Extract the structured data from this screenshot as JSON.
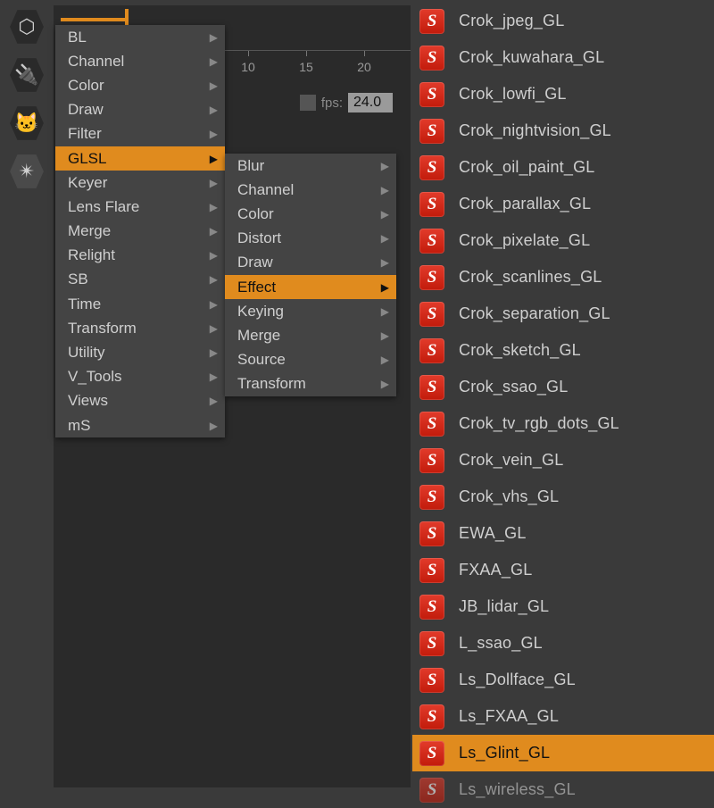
{
  "tool_icons": [
    "hex",
    "plug",
    "emoji",
    "star"
  ],
  "timeline": {
    "ticks": [
      "10",
      "15",
      "20"
    ],
    "fps_label": "fps:",
    "fps_value": "24.0"
  },
  "menu1": {
    "items": [
      {
        "label": "BL",
        "sub": true
      },
      {
        "label": "Channel",
        "sub": true
      },
      {
        "label": "Color",
        "sub": true
      },
      {
        "label": "Draw",
        "sub": true
      },
      {
        "label": "Filter",
        "sub": true
      },
      {
        "label": "GLSL",
        "sub": true,
        "hl": true
      },
      {
        "label": "Keyer",
        "sub": true
      },
      {
        "label": "Lens Flare",
        "sub": true
      },
      {
        "label": "Merge",
        "sub": true
      },
      {
        "label": "Relight",
        "sub": true
      },
      {
        "label": "SB",
        "sub": true
      },
      {
        "label": "Time",
        "sub": true
      },
      {
        "label": "Transform",
        "sub": true
      },
      {
        "label": "Utility",
        "sub": true
      },
      {
        "label": "V_Tools",
        "sub": true
      },
      {
        "label": "Views",
        "sub": true
      },
      {
        "label": "mS",
        "sub": true
      }
    ]
  },
  "menu2": {
    "items": [
      {
        "label": "Blur",
        "sub": true
      },
      {
        "label": "Channel",
        "sub": true
      },
      {
        "label": "Color",
        "sub": true
      },
      {
        "label": "Distort",
        "sub": true
      },
      {
        "label": "Draw",
        "sub": true
      },
      {
        "label": "Effect",
        "sub": true,
        "hl": true
      },
      {
        "label": "Keying",
        "sub": true
      },
      {
        "label": "Merge",
        "sub": true
      },
      {
        "label": "Source",
        "sub": true
      },
      {
        "label": "Transform",
        "sub": true
      }
    ]
  },
  "fx": {
    "items": [
      {
        "label": "Crok_jpeg_GL"
      },
      {
        "label": "Crok_kuwahara_GL"
      },
      {
        "label": "Crok_lowfi_GL"
      },
      {
        "label": "Crok_nightvision_GL"
      },
      {
        "label": "Crok_oil_paint_GL"
      },
      {
        "label": "Crok_parallax_GL"
      },
      {
        "label": "Crok_pixelate_GL"
      },
      {
        "label": "Crok_scanlines_GL"
      },
      {
        "label": "Crok_separation_GL"
      },
      {
        "label": "Crok_sketch_GL"
      },
      {
        "label": "Crok_ssao_GL"
      },
      {
        "label": "Crok_tv_rgb_dots_GL"
      },
      {
        "label": "Crok_vein_GL"
      },
      {
        "label": "Crok_vhs_GL"
      },
      {
        "label": "EWA_GL"
      },
      {
        "label": "FXAA_GL"
      },
      {
        "label": "JB_lidar_GL"
      },
      {
        "label": "L_ssao_GL"
      },
      {
        "label": "Ls_Dollface_GL"
      },
      {
        "label": "Ls_FXAA_GL"
      },
      {
        "label": "Ls_Glint_GL",
        "hl": true
      },
      {
        "label": "Ls_wireless_GL",
        "cut": true
      }
    ]
  }
}
